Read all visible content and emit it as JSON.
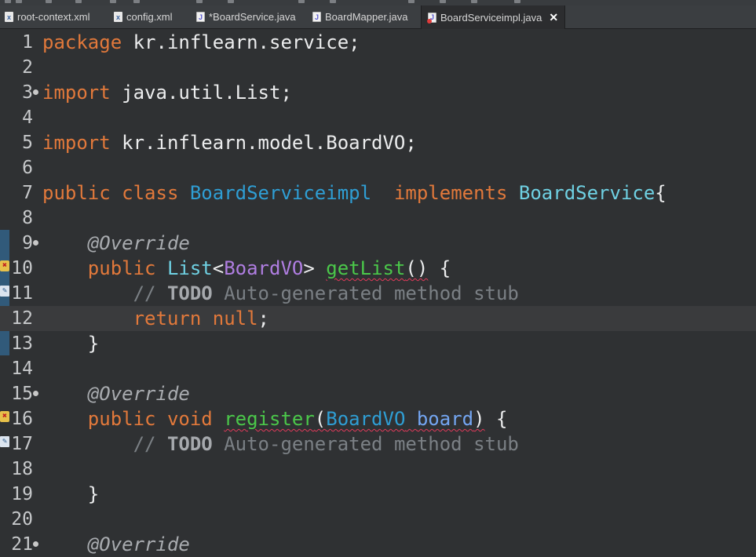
{
  "tabs": [
    {
      "label": "root-context.xml",
      "icon": "xml-file-icon"
    },
    {
      "label": "config.xml",
      "icon": "xml-file-icon"
    },
    {
      "label": "*BoardService.java",
      "icon": "java-file-icon"
    },
    {
      "label": "BoardMapper.java",
      "icon": "java-file-icon"
    },
    {
      "label": "BoardServiceimpl.java",
      "icon": "java-file-error-icon",
      "active": true,
      "close": "✕"
    }
  ],
  "editor": {
    "current_line": 12,
    "lines": [
      {
        "num": "1",
        "tokens": [
          {
            "t": "package",
            "c": "kw"
          },
          {
            "t": " kr.inflearn.service;",
            "c": ""
          }
        ]
      },
      {
        "num": "2",
        "tokens": []
      },
      {
        "num": "3",
        "fold": true,
        "tokens": [
          {
            "t": "import",
            "c": "kw"
          },
          {
            "t": " java.util.List;",
            "c": ""
          }
        ]
      },
      {
        "num": "4",
        "tokens": []
      },
      {
        "num": "5",
        "tokens": [
          {
            "t": "import",
            "c": "kw"
          },
          {
            "t": " kr.inflearn.model.BoardVO;",
            "c": ""
          }
        ]
      },
      {
        "num": "6",
        "tokens": []
      },
      {
        "num": "7",
        "tokens": [
          {
            "t": "public",
            "c": "kw"
          },
          {
            "t": " ",
            "c": ""
          },
          {
            "t": "class",
            "c": "kw"
          },
          {
            "t": " ",
            "c": ""
          },
          {
            "t": "BoardServiceimpl",
            "c": "tp"
          },
          {
            "t": "  ",
            "c": ""
          },
          {
            "t": "implements",
            "c": "kw"
          },
          {
            "t": " ",
            "c": ""
          },
          {
            "t": "BoardService",
            "c": "tp2"
          },
          {
            "t": "{",
            "c": ""
          }
        ]
      },
      {
        "num": "8",
        "tokens": []
      },
      {
        "num": "9",
        "fold": true,
        "tokens": [
          {
            "t": "    ",
            "c": ""
          },
          {
            "t": "@Override",
            "c": "ann"
          }
        ]
      },
      {
        "num": "10",
        "marker": "error",
        "tokens": [
          {
            "t": "    ",
            "c": ""
          },
          {
            "t": "public",
            "c": "kw"
          },
          {
            "t": " ",
            "c": ""
          },
          {
            "t": "List",
            "c": "tp2"
          },
          {
            "t": "<",
            "c": ""
          },
          {
            "t": "BoardVO",
            "c": "gen"
          },
          {
            "t": "> ",
            "c": ""
          },
          {
            "t": "getList",
            "c": "mth squig"
          },
          {
            "t": "()",
            "c": "squig"
          },
          {
            "t": " {",
            "c": ""
          }
        ]
      },
      {
        "num": "11",
        "marker": "task",
        "tokens": [
          {
            "t": "        ",
            "c": ""
          },
          {
            "t": "// ",
            "c": "cm"
          },
          {
            "t": "TODO",
            "c": "todo"
          },
          {
            "t": " Auto-generated method stub",
            "c": "cm"
          }
        ]
      },
      {
        "num": "12",
        "tokens": [
          {
            "t": "        ",
            "c": ""
          },
          {
            "t": "return",
            "c": "kw"
          },
          {
            "t": " ",
            "c": ""
          },
          {
            "t": "null",
            "c": "kw"
          },
          {
            "t": ";",
            "c": ""
          }
        ]
      },
      {
        "num": "13",
        "tokens": [
          {
            "t": "    }",
            "c": ""
          }
        ]
      },
      {
        "num": "14",
        "tokens": []
      },
      {
        "num": "15",
        "fold": true,
        "tokens": [
          {
            "t": "    ",
            "c": ""
          },
          {
            "t": "@Override",
            "c": "ann"
          }
        ]
      },
      {
        "num": "16",
        "marker": "error",
        "tokens": [
          {
            "t": "    ",
            "c": ""
          },
          {
            "t": "public",
            "c": "kw"
          },
          {
            "t": " ",
            "c": ""
          },
          {
            "t": "void",
            "c": "kw"
          },
          {
            "t": " ",
            "c": ""
          },
          {
            "t": "register",
            "c": "mth squig"
          },
          {
            "t": "(",
            "c": "squig"
          },
          {
            "t": "BoardVO",
            "c": "tp squig"
          },
          {
            "t": " ",
            "c": "squig"
          },
          {
            "t": "board",
            "c": "par squig"
          },
          {
            "t": ")",
            "c": "squig"
          },
          {
            "t": " {",
            "c": ""
          }
        ]
      },
      {
        "num": "17",
        "marker": "task",
        "tokens": [
          {
            "t": "        ",
            "c": ""
          },
          {
            "t": "// ",
            "c": "cm"
          },
          {
            "t": "TODO",
            "c": "todo"
          },
          {
            "t": " Auto-generated method stub",
            "c": "cm"
          }
        ]
      },
      {
        "num": "18",
        "tokens": []
      },
      {
        "num": "19",
        "tokens": [
          {
            "t": "    }",
            "c": ""
          }
        ]
      },
      {
        "num": "20",
        "tokens": []
      },
      {
        "num": "21",
        "fold": true,
        "tokens": [
          {
            "t": "    ",
            "c": ""
          },
          {
            "t": "@Override",
            "c": "ann"
          }
        ]
      }
    ]
  }
}
